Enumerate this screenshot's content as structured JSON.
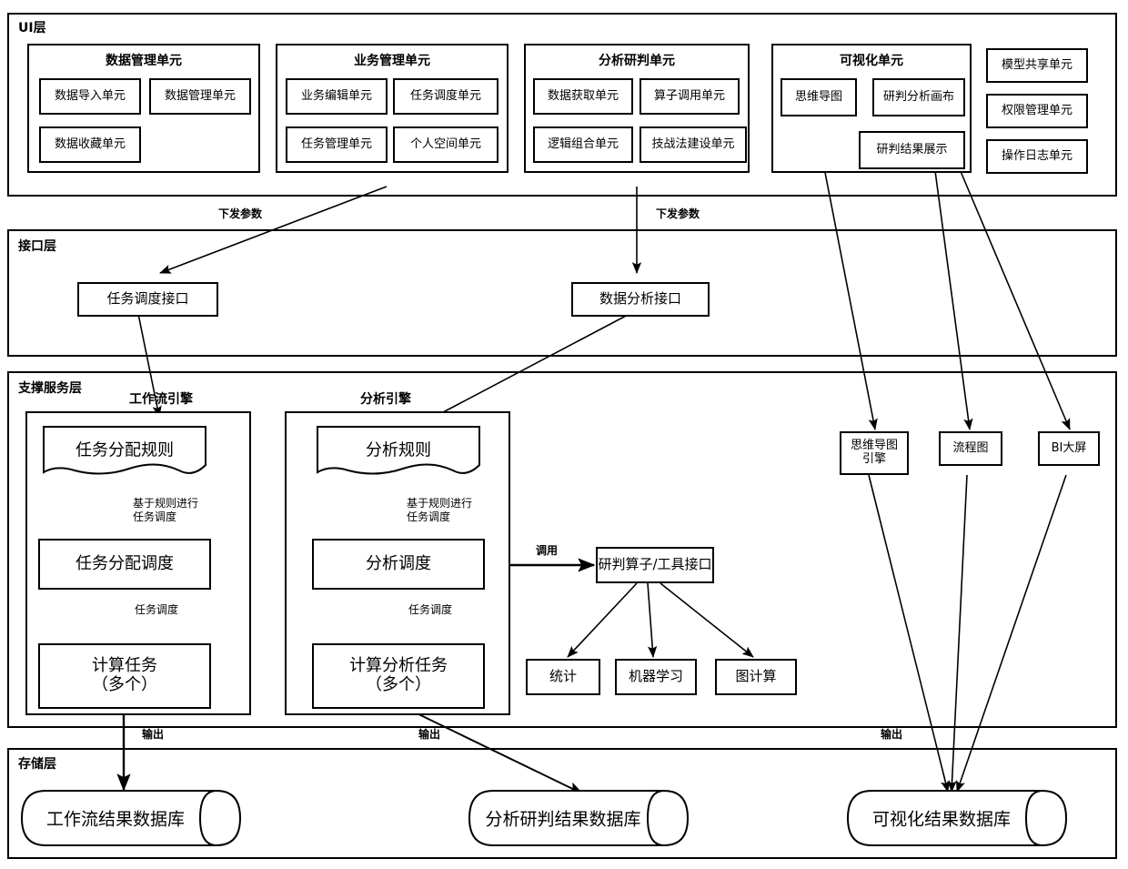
{
  "diagram": {
    "title": "system-architecture",
    "line_color": "#000000",
    "bg_color": "#ffffff"
  },
  "layers": [
    {
      "id": "ui",
      "title": "UI层"
    },
    {
      "id": "interface",
      "title": "接口层"
    },
    {
      "id": "support",
      "title": "支撑服务层"
    },
    {
      "id": "storage",
      "title": "存储层"
    }
  ],
  "ui_layer": {
    "groups": [
      {
        "title": "数据管理单元",
        "items": [
          "数据导入单元",
          "数据管理单元",
          "数据收藏单元"
        ]
      },
      {
        "title": "业务管理单元",
        "items": [
          "业务编辑单元",
          "任务调度单元",
          "任务管理单元",
          "个人空间单元"
        ]
      },
      {
        "title": "分析研判单元",
        "items": [
          "数据获取单元",
          "算子调用单元",
          "逻辑组合单元",
          "技战法建设单元"
        ]
      },
      {
        "title": "可视化单元",
        "items": [
          "思维导图",
          "研判分析画布",
          "研判结果展示"
        ]
      }
    ],
    "standalone": [
      "模型共享单元",
      "权限管理单元",
      "操作日志单元"
    ]
  },
  "interface_layer": {
    "boxes": [
      "任务调度接口",
      "数据分析接口"
    ],
    "edge_labels": [
      "下发参数",
      "下发参数"
    ]
  },
  "support_layer": {
    "engines": [
      {
        "title": "工作流引擎",
        "rule": "任务分配规则",
        "schedule": "任务分配调度",
        "task_line1": "计算任务",
        "task_line2": "（多个）",
        "edge1_line1": "基于规则进行",
        "edge1_line2": "任务调度",
        "edge2": "任务调度"
      },
      {
        "title": "分析引擎",
        "rule": "分析规则",
        "schedule": "分析调度",
        "task_line1": "计算分析任务",
        "task_line2": "（多个）",
        "edge1_line1": "基于规则进行",
        "edge1_line2": "任务调度",
        "edge2": "任务调度"
      }
    ],
    "operator_call_label": "调用",
    "operator_interface": "研判算子/工具接口",
    "operator_children": [
      "统计",
      "机器学习",
      "图计算"
    ],
    "viz_engines": [
      {
        "line1": "思维导图",
        "line2": "引擎"
      },
      {
        "line1": "流程图",
        "line2": ""
      },
      {
        "line1": "BI大屏",
        "line2": ""
      }
    ]
  },
  "storage_layer": {
    "databases": [
      "工作流结果数据库",
      "分析研判结果数据库",
      "可视化结果数据库"
    ],
    "edge_labels": [
      "输出",
      "输出",
      "输出"
    ]
  }
}
